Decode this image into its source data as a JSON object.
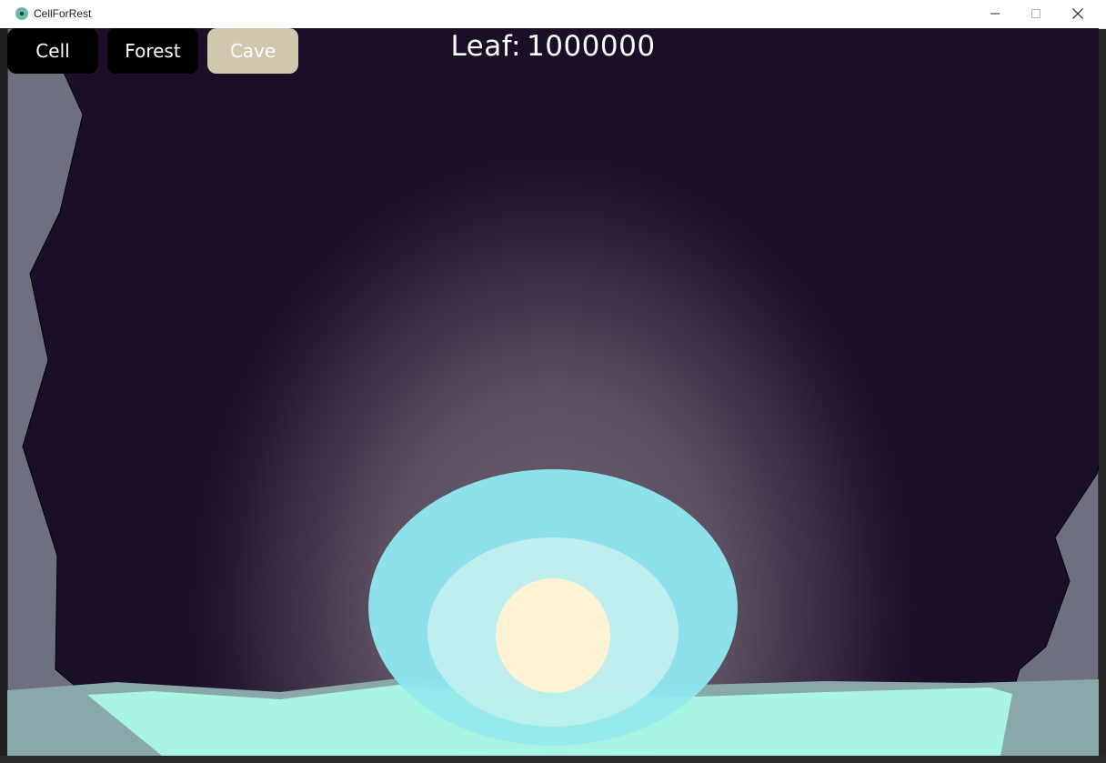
{
  "window": {
    "title": "CellForRest",
    "min_symbol": "—",
    "max_symbol": "☐",
    "close_symbol": "✕"
  },
  "nav": {
    "cell_label": "Cell",
    "forest_label": "Forest",
    "cave_label": "Cave",
    "active": "Cave"
  },
  "hud": {
    "leaf_label": "Leaf:",
    "leaf_value": "1000000"
  },
  "colors": {
    "cave_background": "#1b0e27",
    "cave_wall": "#6e6f7f",
    "glow": "#6e6470",
    "water": "#a9f5e3",
    "orb_outer": "#8fe5f0",
    "orb_middle": "#c7f0ef",
    "orb_core": "#fef3d4",
    "active_tab": "#cfc8ad"
  },
  "icons": {
    "app": "cell-icon",
    "minimize": "minimize-icon",
    "maximize": "maximize-icon",
    "close": "close-icon"
  }
}
